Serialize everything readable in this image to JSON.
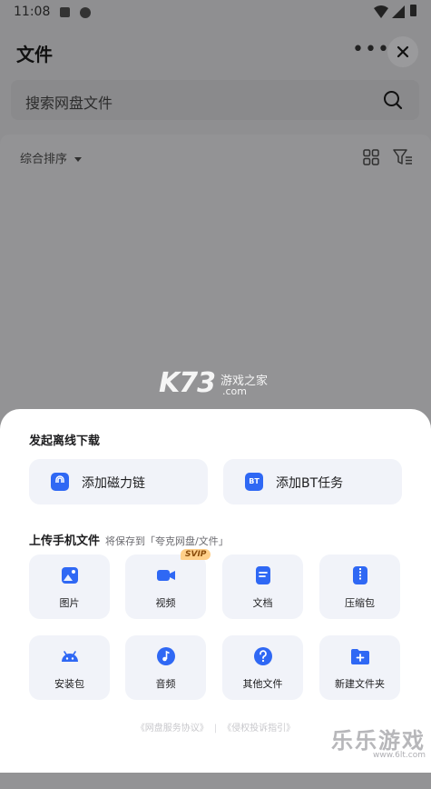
{
  "status_bar": {
    "time": "11:08"
  },
  "header": {
    "title": "文件"
  },
  "search": {
    "placeholder": "搜索网盘文件"
  },
  "toolbar": {
    "sort_label": "综合排序"
  },
  "watermark": {
    "brand": "K73",
    "name": "游戏之家",
    "domain": ".com"
  },
  "sheet": {
    "offline_title": "发起离线下载",
    "offline_actions": [
      {
        "label": "添加磁力链",
        "icon": "magnet-icon"
      },
      {
        "label": "添加BT任务",
        "icon": "bt-icon",
        "icon_text": "BT"
      }
    ],
    "upload_title": "上传手机文件",
    "upload_subtitle": "将保存到「夸克网盘/文件」",
    "tiles": [
      {
        "label": "图片",
        "icon": "image-icon"
      },
      {
        "label": "视频",
        "icon": "video-icon",
        "badge": "SVIP"
      },
      {
        "label": "文档",
        "icon": "document-icon"
      },
      {
        "label": "压缩包",
        "icon": "archive-icon"
      },
      {
        "label": "安装包",
        "icon": "android-icon"
      },
      {
        "label": "音频",
        "icon": "music-icon"
      },
      {
        "label": "其他文件",
        "icon": "question-icon"
      },
      {
        "label": "新建文件夹",
        "icon": "new-folder-icon"
      }
    ],
    "footer_links": [
      "《网盘服务协议》",
      "《侵权投诉指引》"
    ],
    "bottom_watermark": {
      "text": "乐乐游戏",
      "url": "www.6lt.com"
    }
  },
  "colors": {
    "accent": "#2f68f4",
    "tile_bg": "#f1f3f9",
    "badge_bg": "#ffd08a"
  }
}
